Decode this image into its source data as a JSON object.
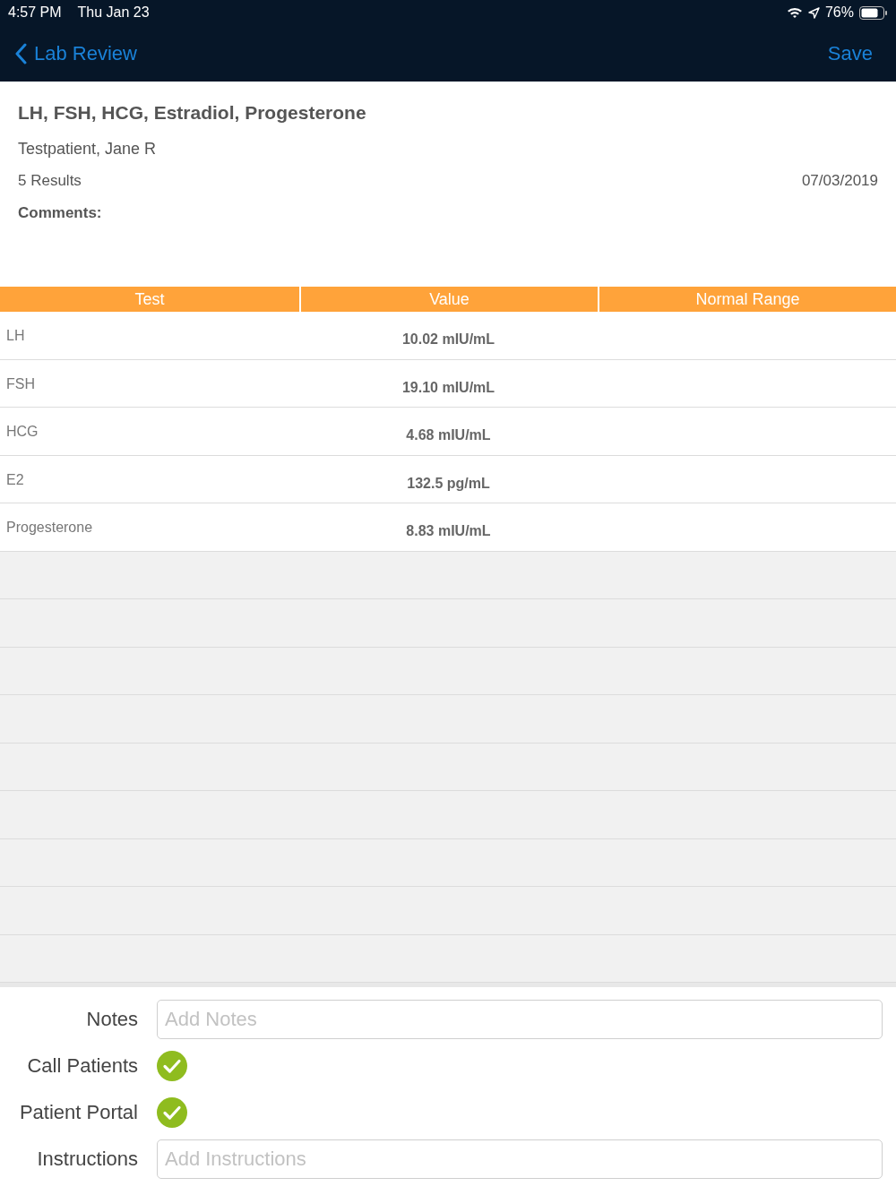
{
  "status_bar": {
    "time": "4:57 PM",
    "date": "Thu Jan 23",
    "battery": "76%"
  },
  "nav": {
    "back": "Lab Review",
    "action": "Save"
  },
  "header": {
    "title": "LH, FSH, HCG, Estradiol, Progesterone",
    "patient": "Testpatient, Jane R",
    "count": "5 Results",
    "date": "07/03/2019",
    "comments_label": "Comments:"
  },
  "table": {
    "columns": [
      "Test",
      "Value",
      "Normal Range"
    ],
    "rows": [
      {
        "test": "LH",
        "value": "10.02 mIU/mL"
      },
      {
        "test": "FSH",
        "value": "19.10 mIU/mL"
      },
      {
        "test": "HCG",
        "value": "4.68 mIU/mL"
      },
      {
        "test": "E2",
        "value": "132.5 pg/mL"
      },
      {
        "test": "Progesterone",
        "value": "8.83 mIU/mL"
      }
    ]
  },
  "form": [
    {
      "kind": "text",
      "label": "Notes",
      "placeholder": "Add Notes"
    },
    {
      "kind": "check",
      "label": "Call Patients",
      "checked": true
    },
    {
      "kind": "check",
      "label": "Patient Portal",
      "checked": true
    },
    {
      "kind": "text",
      "label": "Instructions",
      "placeholder": "Add Instructions"
    }
  ]
}
